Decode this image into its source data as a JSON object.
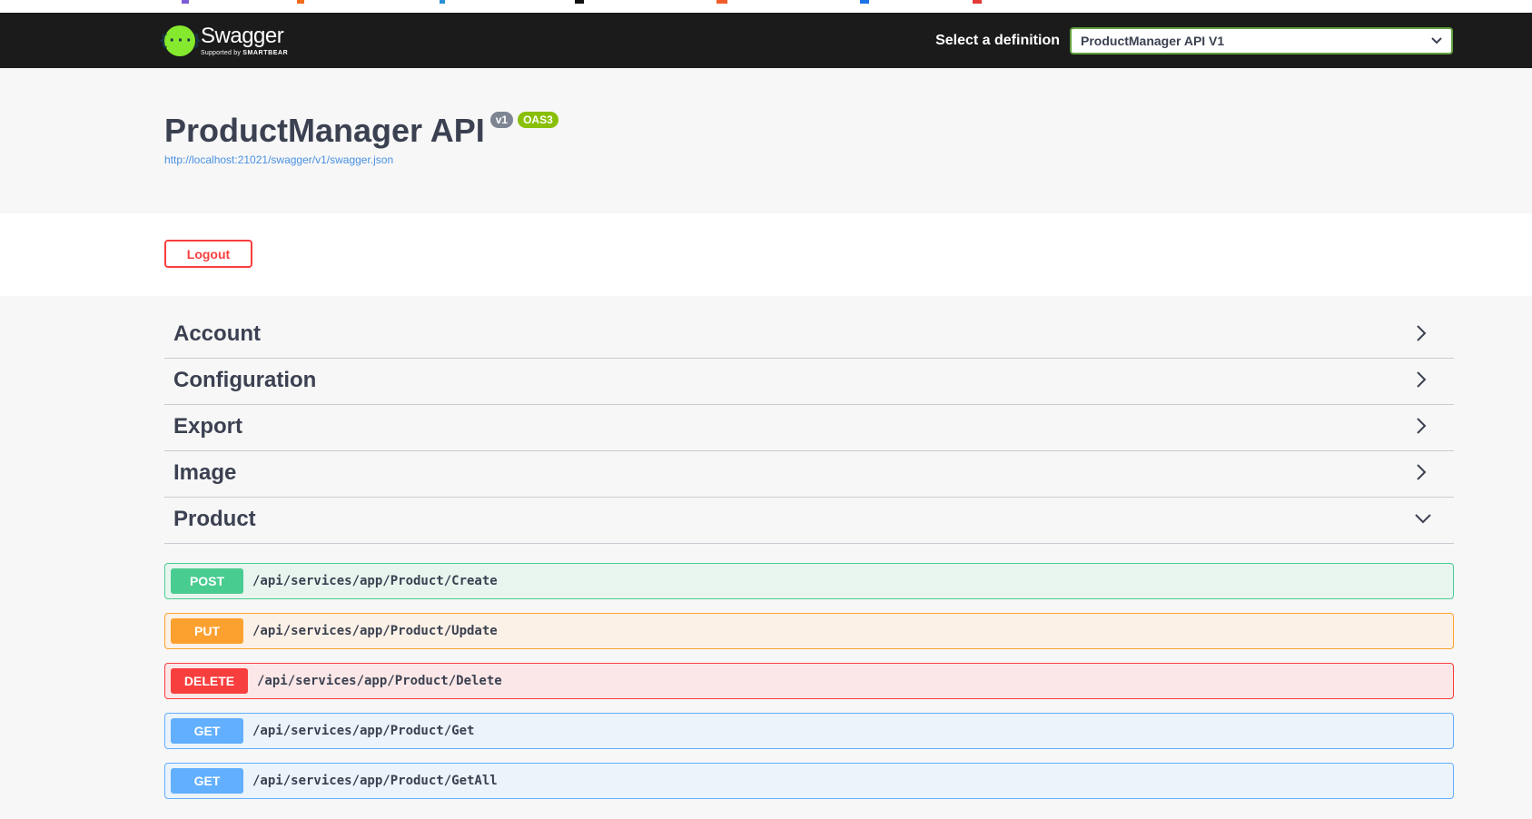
{
  "topbar": {
    "logo_word": "Swagger",
    "logo_sub_prefix": "Supported by",
    "logo_sub_brand": "SMARTBEAR",
    "definition_label": "Select a definition",
    "definition_selected": "ProductManager API V1"
  },
  "info": {
    "title": "ProductManager API",
    "version_badge": "v1",
    "oas_badge": "OAS3",
    "spec_url": "http://localhost:21021/swagger/v1/swagger.json"
  },
  "auth": {
    "logout_label": "Logout"
  },
  "tags": [
    {
      "name": "Account",
      "expanded": false
    },
    {
      "name": "Configuration",
      "expanded": false
    },
    {
      "name": "Export",
      "expanded": false
    },
    {
      "name": "Image",
      "expanded": false
    },
    {
      "name": "Product",
      "expanded": true
    }
  ],
  "operations": [
    {
      "method": "POST",
      "path": "/api/services/app/Product/Create"
    },
    {
      "method": "PUT",
      "path": "/api/services/app/Product/Update"
    },
    {
      "method": "DELETE",
      "path": "/api/services/app/Product/Delete"
    },
    {
      "method": "GET",
      "path": "/api/services/app/Product/Get"
    },
    {
      "method": "GET",
      "path": "/api/services/app/Product/GetAll"
    }
  ],
  "colors": {
    "post": "#49cc90",
    "put": "#fca130",
    "delete": "#f93e3e",
    "get": "#61affe",
    "logo": "#85ea2d",
    "topbar": "#1b1b1b"
  }
}
